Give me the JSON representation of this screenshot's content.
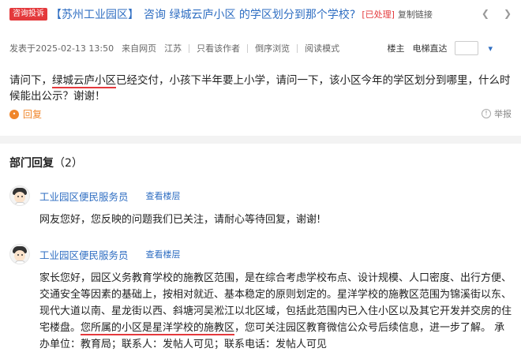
{
  "header": {
    "tag": "咨询投诉",
    "section": "【苏州工业园区】",
    "title": "咨询 绿城云庐小区 的学区划分到那个学校?",
    "status": "[已处理]",
    "copy_link": "复制链接"
  },
  "meta": {
    "posted": "发表于2025-02-13 13:50",
    "source": "来自网页",
    "location": "江苏",
    "author_only": "只看该作者",
    "reverse": "倒序浏览",
    "read_mode": "阅读模式",
    "owner": "楼主",
    "elevator": "电梯直达"
  },
  "question": {
    "before": "请问下，",
    "highlight": "绿城云庐小区",
    "after": "已经交付，小孩下半年要上小学，请问一下，该小区今年的学区划分到哪里，什么时候能出公示？谢谢！",
    "reply_label": "回复",
    "report_label": "举报"
  },
  "dept": {
    "title": "部门回复",
    "count": "（2）"
  },
  "replies": [
    {
      "author": "工业园区便民服务员",
      "view_floor": "查看楼层",
      "body": "网友您好，您反映的问题我们已关注，请耐心等待回复，谢谢!"
    },
    {
      "author": "工业园区便民服务员",
      "view_floor": "查看楼层",
      "body_before": "家长您好，园区义务教育学校的施教区范围，是在综合考虑学校布点、设计规模、人口密度、出行方便、交通安全等因素的基础上，按相对就近、基本稳定的原则划定的。星洋学校的施教区范围为锦溪街以东、现代大道以南、星龙街以西、斜塘河吴淞江以北区域，包括此范围内已入住小区以及其它开发并交房的住宅楼盘。",
      "body_highlight": "您所属的小区是星洋学校的施教区",
      "body_after": "，您可关注园区教育微信公众号后续信息，进一步了解。 承办单位：教育局；联系人：发帖人可见；联系电话：发帖人可见"
    }
  ],
  "icons": {
    "prev": "chevron-left-icon",
    "next": "chevron-right-icon",
    "reply": "reply-icon",
    "report": "report-icon",
    "jump": "chevron-down-icon"
  },
  "colors": {
    "link": "#2f6ec2",
    "accent": "#e4393c",
    "orange": "#f0862b"
  }
}
